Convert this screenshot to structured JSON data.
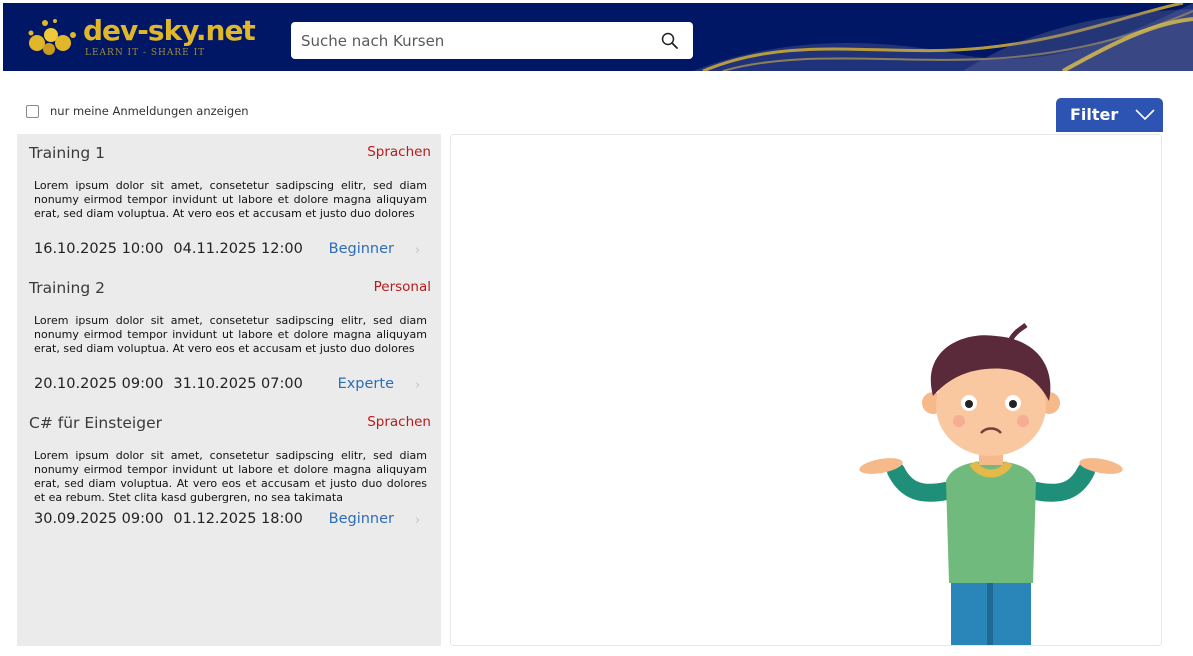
{
  "header": {
    "logo_text": "dev-sky.net",
    "logo_tagline": "LEARN IT - SHARE IT",
    "search_placeholder": "Suche nach Kursen",
    "search_icon": "search-icon",
    "background": "#001766",
    "accent": "#e0b72a"
  },
  "toolbar": {
    "only_my_registrations": "nur meine Anmeldungen anzeigen",
    "only_my_registrations_checked": false,
    "filter_label": "Filter",
    "filter_icon": "chevron-down-icon"
  },
  "courses": [
    {
      "title": "Training 1",
      "category": "Sprachen",
      "description": "Lorem ipsum dolor sit amet, consetetur sadipscing elitr, sed diam nonumy eirmod tempor invidunt ut labore et dolore magna aliquyam erat, sed diam voluptua. At vero eos et accusam et justo duo dolores",
      "start": "16.10.2025 10:00",
      "end": "04.11.2025 12:00",
      "level": "Beginner"
    },
    {
      "title": "Training 2",
      "category": "Personal",
      "description": "Lorem ipsum dolor sit amet, consetetur sadipscing elitr, sed diam nonumy eirmod tempor invidunt ut labore et dolore magna aliquyam erat, sed diam voluptua. At vero eos et accusam et justo duo dolores",
      "start": "20.10.2025 09:00",
      "end": "31.10.2025 07:00",
      "level": "Experte"
    },
    {
      "title": "C# für Einsteiger",
      "category": "Sprachen",
      "description": "Lorem ipsum dolor sit amet, consetetur sadipscing elitr, sed diam nonumy eirmod tempor invidunt ut labore et dolore magna aliquyam erat, sed diam voluptua. At vero eos et accusam et justo duo dolores et ea rebum. Stet clita kasd gubergren, no sea takimata",
      "start": "30.09.2025 09:00",
      "end": "01.12.2025 18:00",
      "level": "Beginner"
    }
  ],
  "colors": {
    "category": "#b71c1c",
    "level": "#2f6db5",
    "filter_button": "#2d54b3",
    "list_background": "#ebebeb"
  },
  "detail": {
    "illustration": "confused-person-shrugging"
  }
}
